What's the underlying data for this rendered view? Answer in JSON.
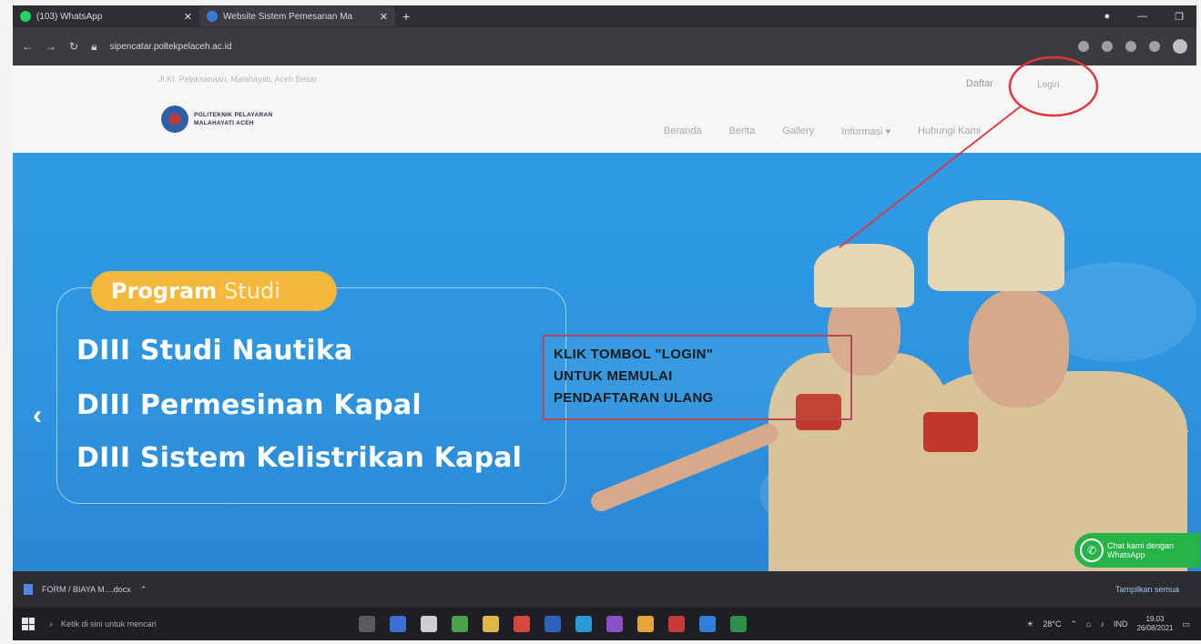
{
  "browser": {
    "tabs": [
      {
        "label": "(103) WhatsApp",
        "active": false
      },
      {
        "label": "Website Sistem Pemesanan Ma",
        "active": true
      }
    ],
    "url": "sipencatar.poltekpelaceh.ac.id"
  },
  "site": {
    "top_line": "Jl.KI. Pelaksanaan, Malahayati, Aceh Besar",
    "daftar_label": "Daftar",
    "login_label": "Login",
    "logo_line1": "POLITEKNIK PELAYARAN",
    "logo_line2": "MALAHAYATI ACEH",
    "nav": [
      "Beranda",
      "Berita",
      "Gallery",
      "Informasi",
      "Hubungi Kami"
    ]
  },
  "hero": {
    "program_bold": "Program",
    "program_light": "Studi",
    "prodi": [
      "DIII Studi Nautika",
      "DIII Permesinan Kapal",
      "DIII Sistem Kelistrikan Kapal"
    ],
    "arrow_left": "‹",
    "arrow_right": "›"
  },
  "annotation": {
    "lines": [
      "KLIK TOMBOL \"LOGIN\"",
      "UNTUK MEMULAI",
      "PENDAFTARAN ULANG"
    ],
    "color": "#e0343f"
  },
  "whatsapp": {
    "line1": "Chat kami dengan",
    "line2": "WhatsApp"
  },
  "download_bar": {
    "file": "FORM / BIAYA M....docx",
    "show_all": "Tampilkan semua"
  },
  "taskbar": {
    "search_placeholder": "Ketik di sini untuk mencari",
    "weather": "28°C",
    "language": "IND",
    "time": "19.03",
    "date": "26/08/2021"
  }
}
